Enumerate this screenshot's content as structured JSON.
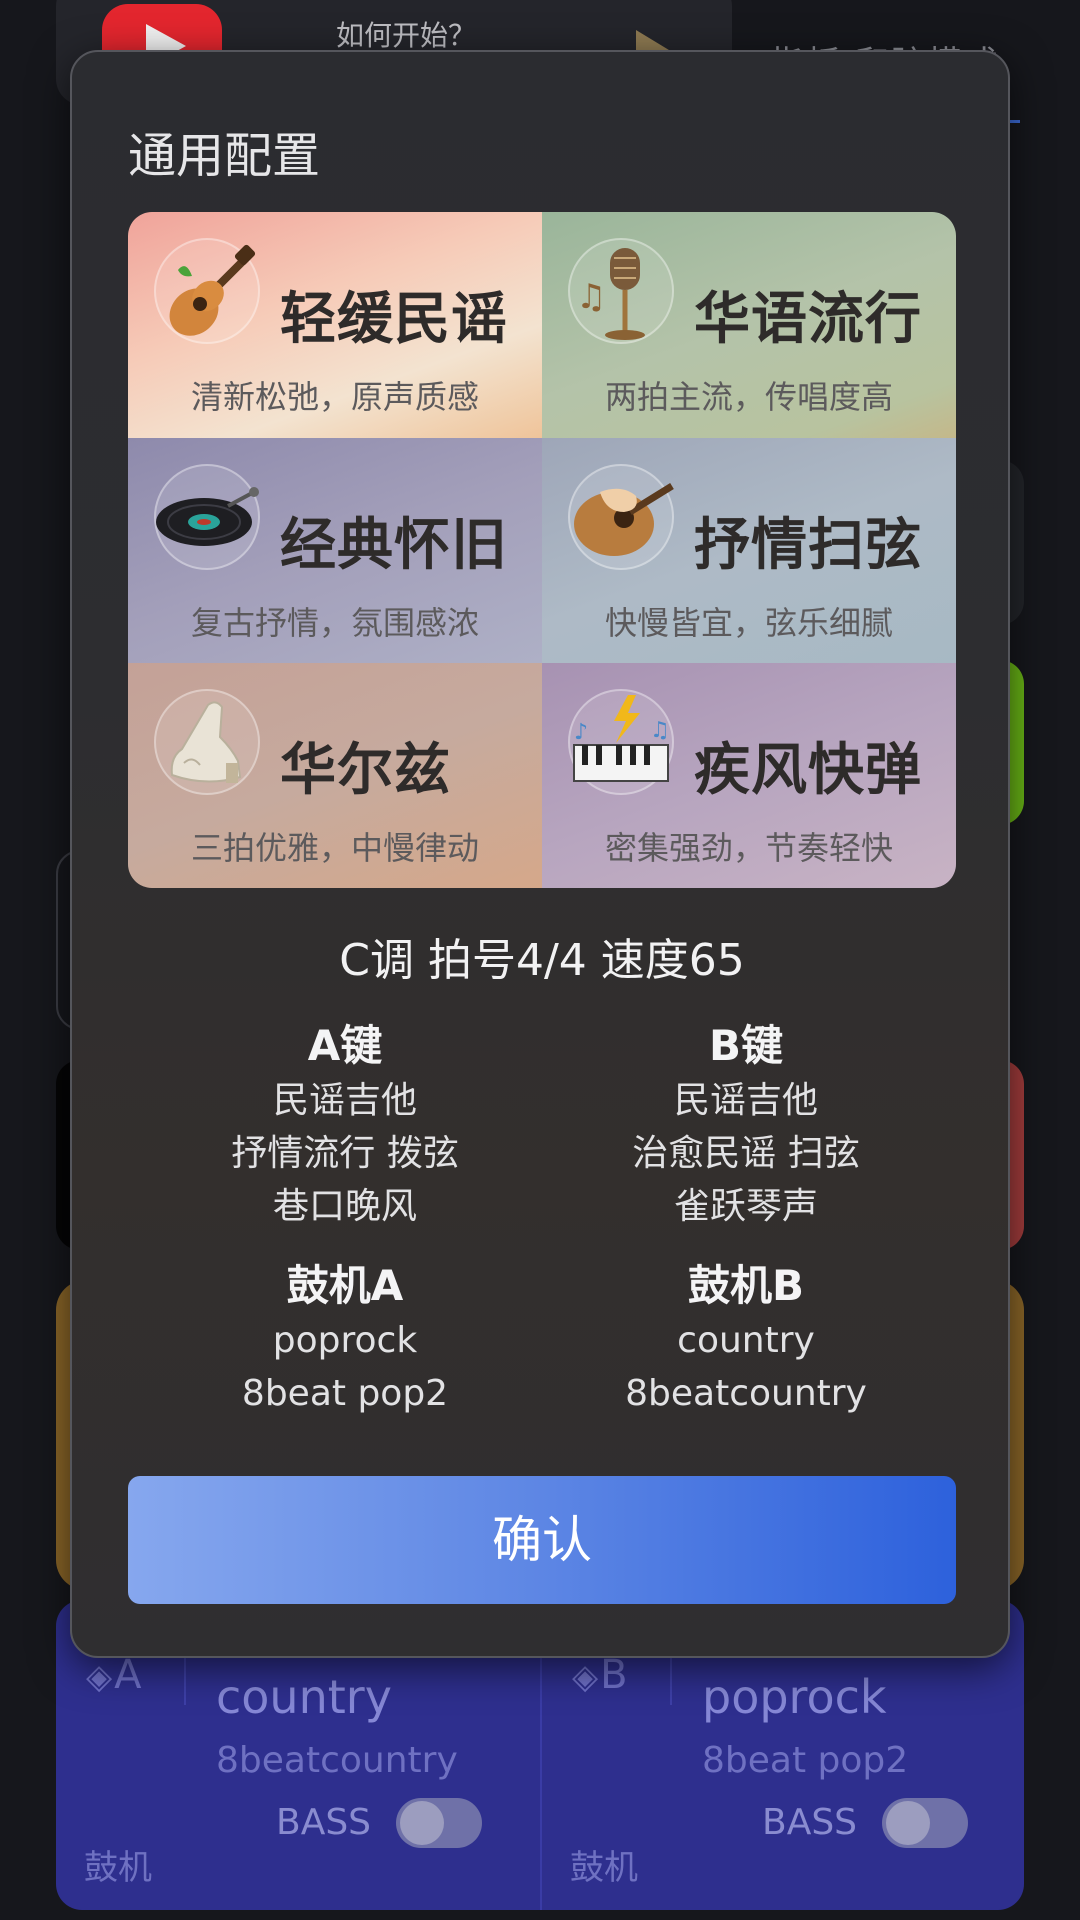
{
  "background": {
    "top_card_text": "如何开始？",
    "mode_text": "指板/和弦模式",
    "drum_panel": {
      "left": {
        "badge": "A",
        "name": "country",
        "sub": "8beatcountry",
        "bass_label": "BASS",
        "label": "鼓机",
        "bass_on": false
      },
      "right": {
        "badge": "B",
        "name": "poprock",
        "sub": "8beat pop2",
        "bass_label": "BASS",
        "label": "鼓机",
        "bass_on": false
      }
    }
  },
  "modal": {
    "title": "通用配置",
    "styles": [
      {
        "name": "轻缓民谣",
        "desc": "清新松弛，原声质感",
        "icon": "acoustic-guitar-icon"
      },
      {
        "name": "华语流行",
        "desc": "两拍主流，传唱度高",
        "icon": "microphone-icon"
      },
      {
        "name": "经典怀旧",
        "desc": "复古抒情，氛围感浓",
        "icon": "vinyl-record-icon"
      },
      {
        "name": "抒情扫弦",
        "desc": "快慢皆宜，弦乐细腻",
        "icon": "strumming-hand-icon"
      },
      {
        "name": "华尔兹",
        "desc": "三拍优雅，中慢律动",
        "icon": "high-heel-shoe-icon"
      },
      {
        "name": "疾风快弹",
        "desc": "密集强劲，节奏轻快",
        "icon": "lightning-piano-icon"
      }
    ],
    "info": "C调 拍号4/4 速度65",
    "key_a": {
      "title": "A键",
      "items": [
        "民谣吉他",
        "抒情流行 拨弦",
        "巷口晚风"
      ]
    },
    "key_b": {
      "title": "B键",
      "items": [
        "民谣吉他",
        "治愈民谣 扫弦",
        "雀跃琴声"
      ]
    },
    "drum_a": {
      "title": "鼓机A",
      "items": [
        "poprock",
        "8beat pop2"
      ]
    },
    "drum_b": {
      "title": "鼓机B",
      "items": [
        "country",
        "8beatcountry"
      ]
    },
    "confirm_label": "确认"
  }
}
